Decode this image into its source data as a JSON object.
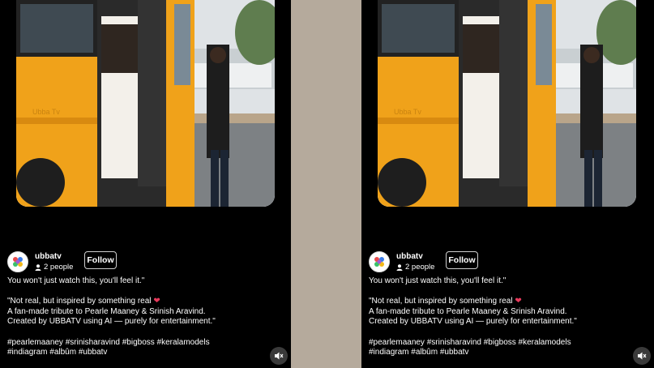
{
  "posts": [
    {
      "username": "ubbatv",
      "people_count": "2 people",
      "follow_label": "Follow",
      "bus_text": "Ubba Tv",
      "caption_line1": "You won't just watch this, you'll feel it.\"",
      "caption_line2": "\"Not real, but inspired by something real",
      "caption_line3": "A fan-made tribute to Pearle Maaney & Srinish Aravind.",
      "caption_line4": "Created by UBBATV using AI — purely for entertainment.\"",
      "hashtags_line1": "#pearlemaaney #srinisharavind #bigboss #keralamodels",
      "hashtags_line2": "#indiagram #albûm #ubbatv"
    },
    {
      "username": "ubbatv",
      "people_count": "2 people",
      "follow_label": "Follow",
      "bus_text": "Ubba Tv",
      "caption_line1": "You won't just watch this, you'll feel it.\"",
      "caption_line2": "\"Not real, but inspired by something real",
      "caption_line3": "A fan-made tribute to Pearle Maaney & Srinish Aravind.",
      "caption_line4": "Created by UBBATV using AI — purely for entertainment.\"",
      "hashtags_line1": "#pearlemaaney #srinisharavind #bigboss #keralamodels",
      "hashtags_line2": "#indiagram #albûm #ubbatv"
    }
  ],
  "icons": {
    "heart": "heart-icon",
    "people": "people-icon",
    "mute": "mute-icon"
  },
  "colors": {
    "panel_bg": "#000000",
    "divider": "#b5aa9c",
    "bus_yellow": "#f0a21a",
    "heart": "#e83a5c"
  }
}
